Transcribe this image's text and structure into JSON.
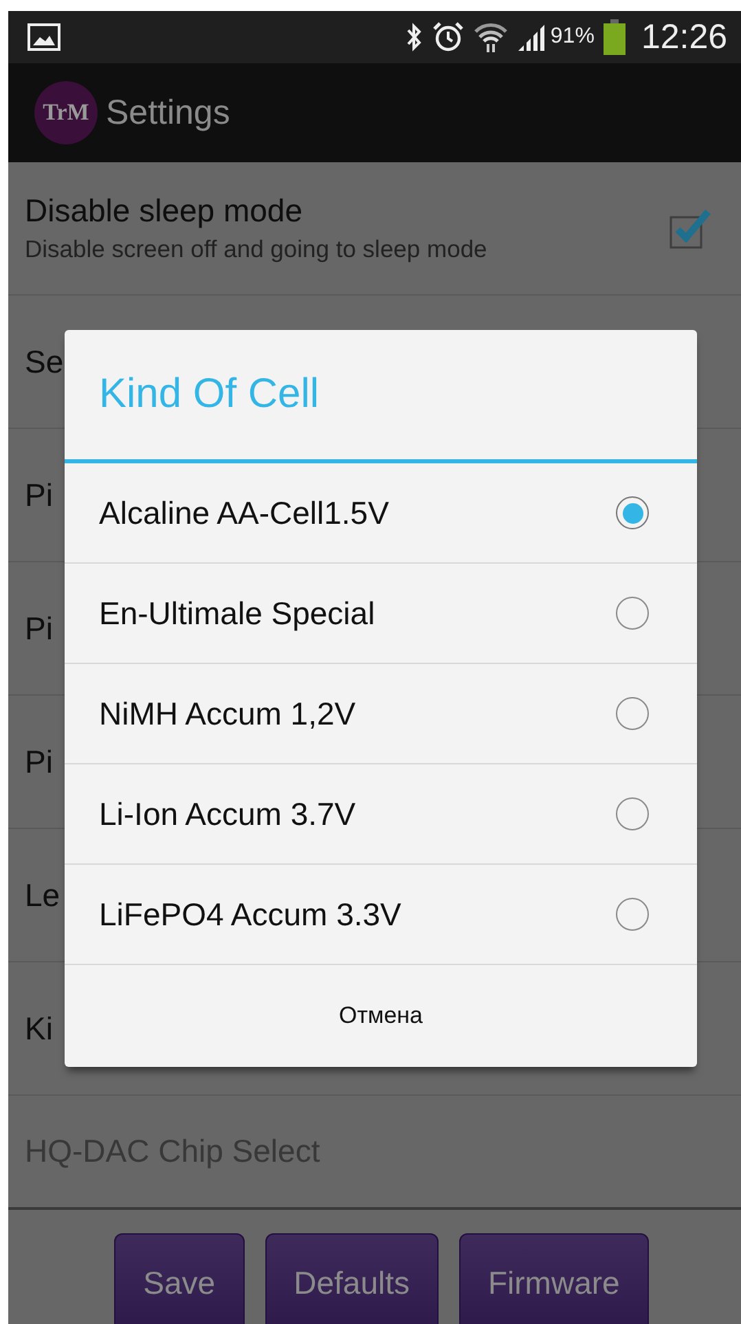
{
  "status_bar": {
    "battery": "91%",
    "time": "12:26"
  },
  "action_bar": {
    "logo": "TrM",
    "title": "Settings"
  },
  "settings": [
    {
      "title": "Disable sleep mode",
      "summary": "Disable screen off and going to sleep mode",
      "checked": true,
      "disabled": false
    },
    {
      "title": "Se",
      "disabled": false
    },
    {
      "title": "Pi",
      "disabled": false
    },
    {
      "title": "Pi",
      "disabled": false
    },
    {
      "title": "Pi",
      "disabled": false
    },
    {
      "title": "Le",
      "disabled": false
    },
    {
      "title": "Ki",
      "disabled": false
    },
    {
      "title": "HQ-DAC Chip Select",
      "disabled": true
    }
  ],
  "buttons": [
    "Save",
    "Defaults",
    "Firmware"
  ],
  "dialog": {
    "title": "Kind Of Cell",
    "options": [
      {
        "label": "Alcaline AA-Cell1.5V",
        "selected": true
      },
      {
        "label": "En-Ultimale Special",
        "selected": false
      },
      {
        "label": "NiMH Accum 1,2V",
        "selected": false
      },
      {
        "label": "Li-Ion Accum 3.7V",
        "selected": false
      },
      {
        "label": "LiFePO4 Accum 3.3V",
        "selected": false
      }
    ],
    "cancel": "Отмена"
  }
}
